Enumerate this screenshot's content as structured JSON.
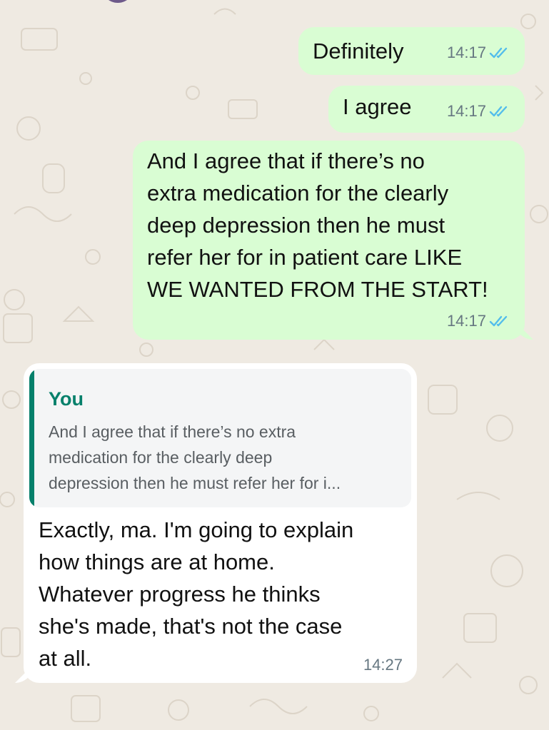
{
  "chat": {
    "background_color": "#efeae2",
    "outgoing_bubble_color": "#d9fdd3",
    "incoming_bubble_color": "#ffffff",
    "read_tick_color": "#53bdeb"
  },
  "messages": [
    {
      "direction": "outgoing",
      "text": "Definitely",
      "time": "14:17",
      "status": "read"
    },
    {
      "direction": "outgoing",
      "text": "I agree",
      "time": "14:17",
      "status": "read"
    },
    {
      "direction": "outgoing",
      "lines": [
        "And I agree that if there’s no",
        "extra medication for the clearly",
        "deep depression then he must",
        "refer her for in patient care LIKE",
        "WE WANTED FROM THE START!"
      ],
      "time": "14:17",
      "status": "read"
    },
    {
      "direction": "incoming",
      "reply_to": {
        "author": "You",
        "lines": [
          "And I agree that if there’s no extra",
          "medication for the clearly deep",
          "depression then he must refer her for i..."
        ]
      },
      "lines": [
        "Exactly, ma. I'm going to explain",
        "how things are at home.",
        "Whatever progress he thinks",
        "she's made, that's not the case",
        "at all."
      ],
      "time": "14:27"
    }
  ]
}
